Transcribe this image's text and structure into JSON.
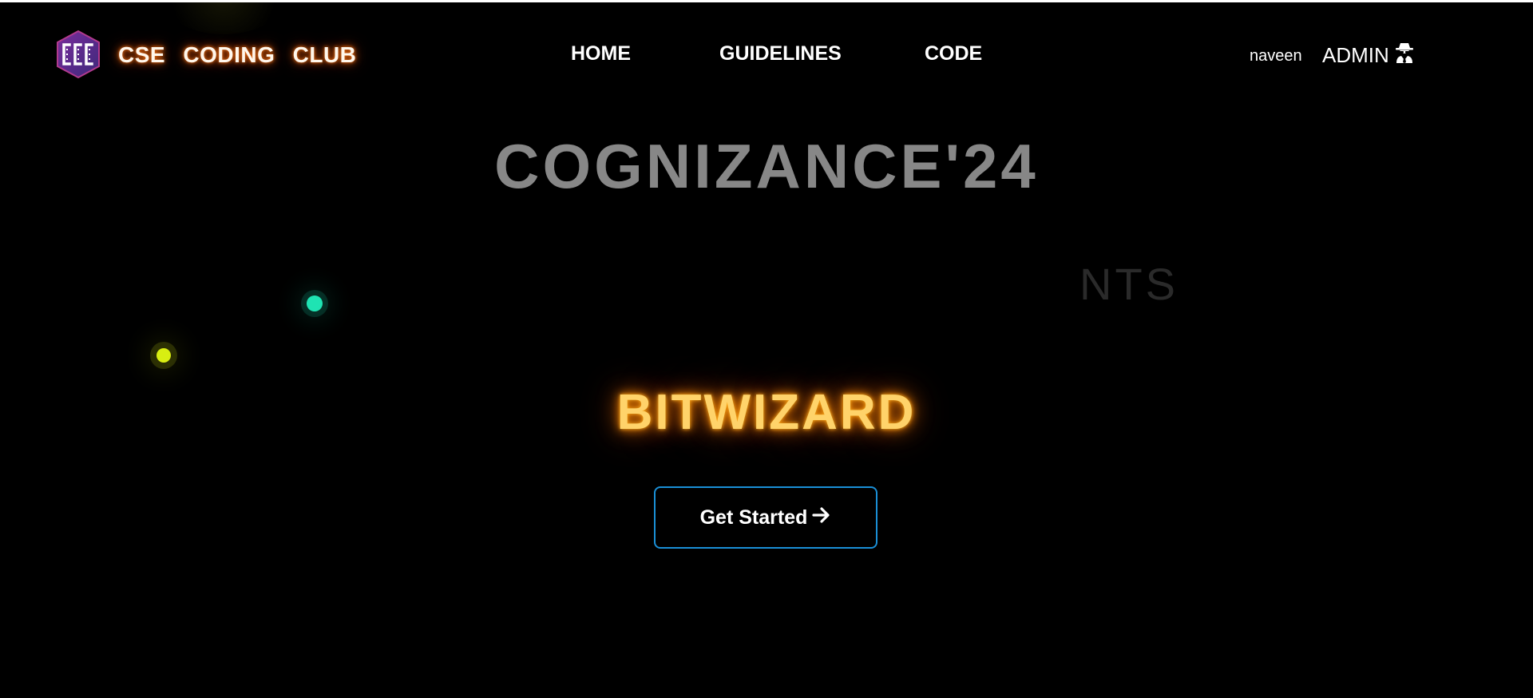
{
  "brand": {
    "name": "CSE  CODING  CLUB",
    "logo_icon": "ccc-hexagon-logo-icon"
  },
  "nav": {
    "links": [
      {
        "label": "HOME"
      },
      {
        "label": "GUIDELINES"
      },
      {
        "label": "CODE"
      }
    ],
    "user_name": "naveen",
    "admin_label": "ADMIN",
    "admin_icon": "user-secret-icon"
  },
  "hero": {
    "event_title": "COGNIZANCE'24",
    "fading_text": "NTS",
    "event_name": "BITWIZARD",
    "cta_label": "Get Started",
    "cta_icon": "arrow-right-icon"
  },
  "colors": {
    "background": "#000000",
    "brand_glow": "#ff7a1a",
    "event_name": "#ffd36a",
    "cta_border": "#1a8fd6",
    "particle_cyan": "#1fe3b3",
    "particle_yellow": "#d8ee12"
  }
}
